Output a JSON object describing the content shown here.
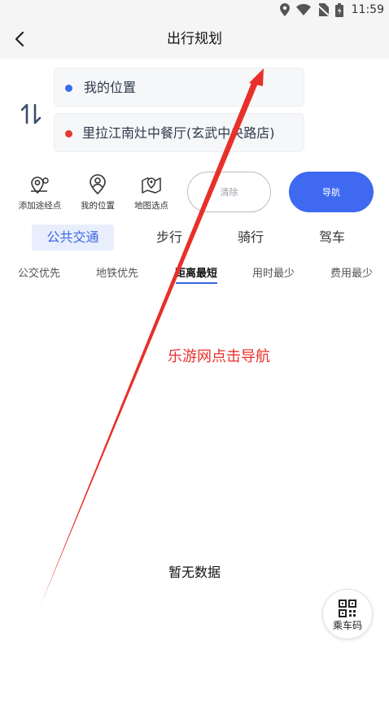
{
  "status_bar": {
    "time": "11:59"
  },
  "header": {
    "title": "出行规划"
  },
  "locations": {
    "start": "我的位置",
    "end": "里拉江南灶中餐厅(玄武中央路店)"
  },
  "tools": [
    {
      "label": "添加途经点",
      "icon": "add-waypoint-icon"
    },
    {
      "label": "我的位置",
      "icon": "my-location-icon"
    },
    {
      "label": "地图选点",
      "icon": "map-pick-icon"
    }
  ],
  "buttons": {
    "clear": "清除",
    "navigate": "导航"
  },
  "mode_tabs": [
    "公共交通",
    "步行",
    "骑行",
    "驾车"
  ],
  "sub_tabs": [
    "公交优先",
    "地铁优先",
    "距离最短",
    "用时最少",
    "费用最少"
  ],
  "annotation": "乐游网点击导航",
  "empty_text": "暂无数据",
  "qr_button": {
    "label": "乘车码",
    "icon": "qr-code-icon"
  },
  "colors": {
    "accent": "#3e69f0",
    "start_dot": "#3a6cf0",
    "end_dot": "#e33a2b",
    "annotation": "#e8302a"
  }
}
